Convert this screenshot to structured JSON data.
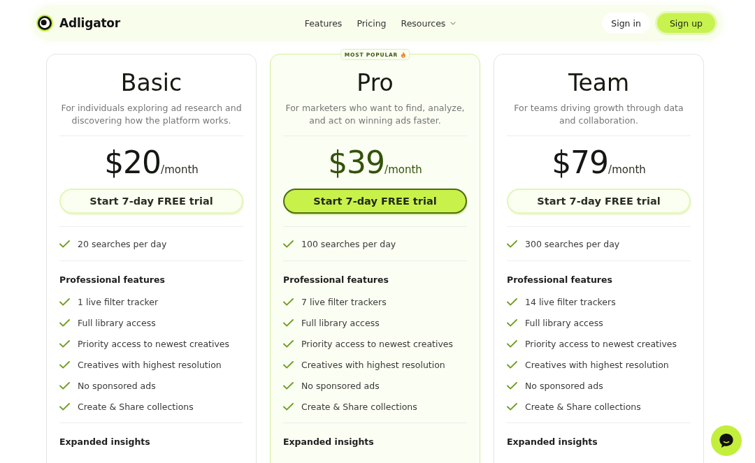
{
  "nav": {
    "brand": "Adligator",
    "links": [
      {
        "label": "Features",
        "has_menu": false
      },
      {
        "label": "Pricing",
        "has_menu": false
      },
      {
        "label": "Resources",
        "has_menu": true
      }
    ],
    "sign_in": "Sign in",
    "sign_up": "Sign up"
  },
  "plans": [
    {
      "name": "Basic",
      "featured": false,
      "description": "For individuals exploring ad research and discovering how the platform works.",
      "price": "$20",
      "period": "/month",
      "cta": "Start 7-day FREE trial",
      "quota": "20 searches per day",
      "sections": [
        {
          "title": "Professional features",
          "items": [
            "1 live filter tracker",
            "Full library access",
            "Priority access to newest creatives",
            "Creatives with highest resolution",
            "No sponsored ads",
            "Create & Share collections"
          ]
        },
        {
          "title": "Expanded insights"
        }
      ]
    },
    {
      "name": "Pro",
      "featured": true,
      "badge": "MOST POPULAR",
      "description": "For marketers who want to find, analyze, and act on winning ads faster.",
      "price": "$39",
      "period": "/month",
      "cta": "Start 7-day FREE trial",
      "quota": "100 searches per day",
      "sections": [
        {
          "title": "Professional features",
          "items": [
            "7 live filter trackers",
            "Full library access",
            "Priority access to newest creatives",
            "Creatives with highest resolution",
            "No sponsored ads",
            "Create & Share collections"
          ]
        },
        {
          "title": "Expanded insights"
        }
      ]
    },
    {
      "name": "Team",
      "featured": false,
      "description": "For teams driving growth through data and collaboration.",
      "price": "$79",
      "period": "/month",
      "cta": "Start 7-day FREE trial",
      "quota": "300 searches per day",
      "sections": [
        {
          "title": "Professional features",
          "items": [
            "14 live filter trackers",
            "Full library access",
            "Priority access to newest creatives",
            "Creatives with highest resolution",
            "No sponsored ads",
            "Create & Share collections"
          ]
        },
        {
          "title": "Expanded insights"
        }
      ]
    }
  ]
}
